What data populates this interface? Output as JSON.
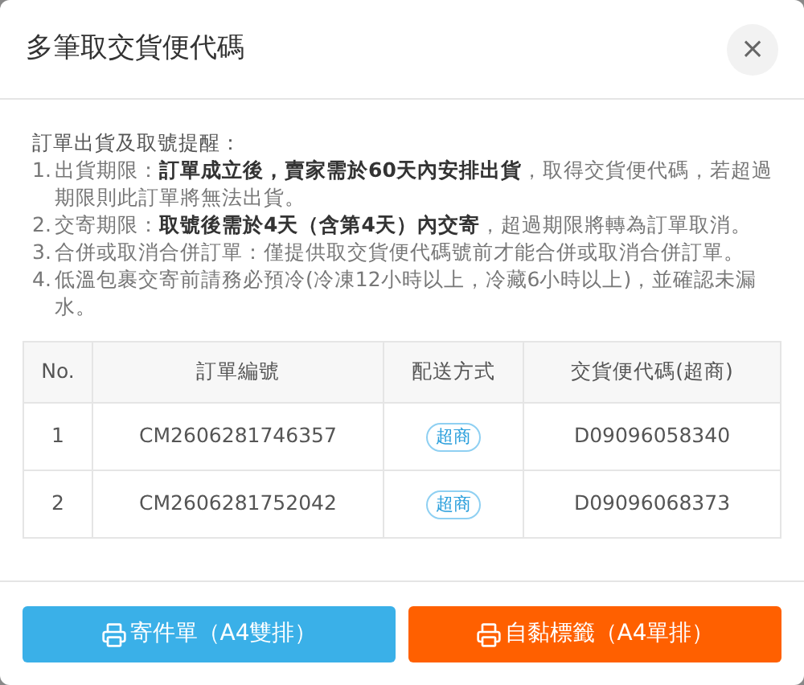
{
  "dialog": {
    "title": "多筆取交貨便代碼",
    "close": "×"
  },
  "notice": {
    "heading": "訂單出貨及取號提醒：",
    "items": [
      {
        "number": "1.",
        "text": "出貨期限：**訂單成立後，賣家需於60天內安排出貨**，取得交貨便代碼，若超過期限則此訂單將無法出貨。"
      },
      {
        "number": "2.",
        "text": "交寄期限：**取號後需於4天（含第4天）內交寄**，超過期限將轉為訂單取消。"
      },
      {
        "number": "3.",
        "text": "合併或取消合併訂單：僅提供取交貨便代碼號前才能合併或取消合併訂單。"
      },
      {
        "number": "4.",
        "text": "低溫包裹交寄前請務必預冷(冷凍12小時以上，冷藏6小時以上)，並確認未漏水。"
      }
    ]
  },
  "table": {
    "columns": [
      "No.",
      "訂單編號",
      "配送方式",
      "交貨便代碼(超商)"
    ],
    "rows": [
      {
        "no": "1",
        "order": "CM2606281746357",
        "shipping": "超商",
        "code": "D09096058340"
      },
      {
        "no": "2",
        "order": "CM2606281752042",
        "shipping": "超商",
        "code": "D09096068373"
      }
    ]
  },
  "buttons": [
    {
      "label": "寄件單（A4雙排）",
      "kind": "primary"
    },
    {
      "label": "自黏標籤（A4單排）",
      "kind": "warning"
    }
  ]
}
